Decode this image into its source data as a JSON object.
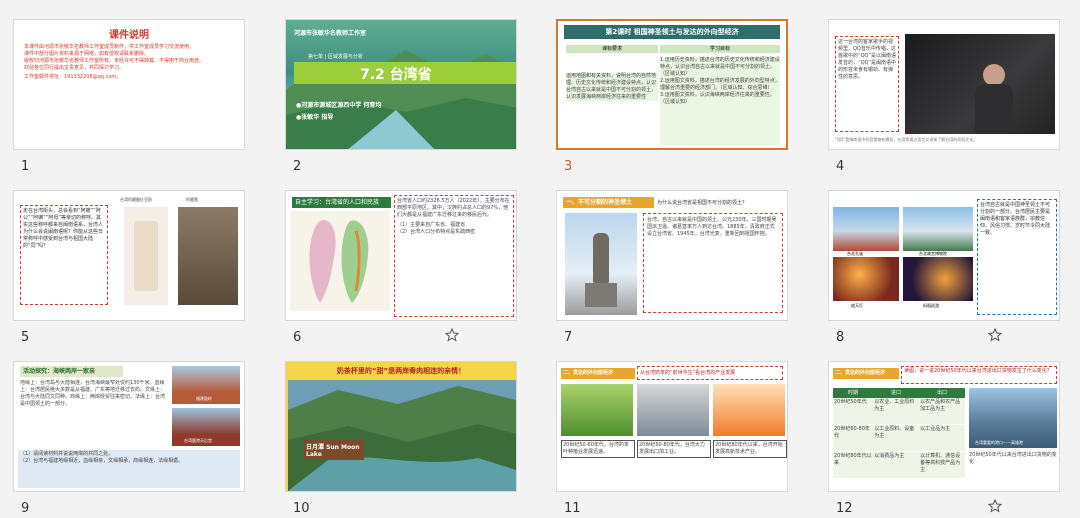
{
  "slides": [
    {
      "num": "1",
      "title": "课件说明",
      "lines": [
        "本课件由河源市张敏华名教师工作室成员制作，供工作室成员学习交流使用。",
        "课件中部分图片资料来源于网络，如有侵权请联系删除。",
        "版权归河源市张敏华名教师工作室所有，未经许可不得转载、不得用于商业用途。",
        "欢迎各位同行提出宝贵意见，共同探讨学习。"
      ],
      "contact": "工作室邮件地址：191332208@qq.com。"
    },
    {
      "num": "2",
      "studio": "河源市张敏华名教师工作室",
      "grade": "第七单 | 区域发展与分析",
      "title": "7.2 台湾省",
      "school": "●河源市源城区源西中学  何育均",
      "teacher": "●张敏华  指导"
    },
    {
      "num": "3",
      "title": "第2课时  祖国神圣领土与发达的外向型经济",
      "col1": "课标要求",
      "col2": "学习目标",
      "req": "运用地图和有关资料，说明台湾的自然地理、历史文化传统和经济建设特点，认识台湾自古以来就是中国不可分割的领土，认识发展海峡两岸经济往来的重要性",
      "goals": [
        "1.运用历史资料，描述台湾的历史文化传统和经济建设特点，认识台湾自古以来就是中国不可分割的领土。（区域认知）",
        "2.运用图文资料，描述台湾的经济发展的外向型特点，理解台湾重要的经济部门。（区域认知、综合思维）",
        "3.运用图文资料，认识海峡两岸经济往来的重要性。（区域认知）"
      ]
    },
    {
      "num": "4",
      "text": "这一台湾的客家歌手的视频里，QQ音乐中传唱，这首歌中的“QQ”是以闽南语发音的，“QQ”是闽南语中的形容米食有嚼劲、有弹性的意思。",
      "footnote": "“QQ”是闽南语中形容食物有嚼劲，台湾常通过语言交流来了解台湾的风俗文化。"
    },
    {
      "num": "5",
      "text": "走在台湾街头，总会看到“阿嬷”“阿公”“阿嫲”“阿母”等亲切的称呼。其实这些称呼都来自闽南语系，台湾人为什么会说闽南语呢？你能从这些日常称呼中感受到台湾与祖国大陆的“同”吗？",
      "tag1": "台湾阿嬷酿红豆奶",
      "tag2": "阿嬷厝"
    },
    {
      "num": "6",
      "header": "自主学习：台湾省的人口和民族",
      "text": "台湾省人口约2326.5万人（2022年），主要分布在西部平原地区。其中，汉族约占总人口的97%，他们大都是从福建广东迁移过来的移民后代。",
      "q1": "（1）主要来自广东省、福建省",
      "q2": "（2）台湾人口分布特点是东疏西密"
    },
    {
      "num": "7",
      "section": "一、不可分割的神圣领土",
      "question": "为什么说台湾省是祖国不可分割的领土？",
      "text": "台湾，自古以来就是中国的领土。公元230年，三国时期吴国派卫温、诸葛直率万人到达台湾。1885年，清政府正式设立台湾省。1945年，台湾光复，重新回到祖国怀抱。"
    },
    {
      "num": "8",
      "text": "台湾自古就是中国神圣领土不可分割的一部分。台湾居民主要是闽南语和客家语族群，宗教信仰、风俗习惯、岁时节令同大陆一致。",
      "captions": [
        "台北孔庙",
        "台北故宫博物院",
        "放天灯",
        "妈祖巡游"
      ]
    },
    {
      "num": "9",
      "header": "活动探究：海峡两岸一家亲",
      "text": "地缘上：台湾岛与大陆相连，台湾海峡最窄处仅约130千米。血缘上：台湾居民绝大多数是从福建、广东等地迁移过去的。文缘上：台湾与大陆同文同种。商缘上：两岸经贸往来密切。法缘上：台湾是中国领土的一部分。",
      "tags": [
        "福建鼓岭",
        "台湾鹿港天后宫"
      ],
      "answers": [
        "（1）请阅读材料并说说两岸的共同之处。",
        "（2）台湾与福建地缘相近，血缘相亲，文缘相承，商缘相连，法缘相循。"
      ]
    },
    {
      "num": "10",
      "title": "奶茶杯里的“甜”是两岸骨肉相连的亲情！",
      "sign": "日月潭 Sun Moon Lake"
    },
    {
      "num": "11",
      "section": "二、发达的外向型经济",
      "question": "从台湾奶茶的“前世今生”看台湾的产业发展",
      "texts": [
        "20世纪50-60年代，台湾的茶叶种植业发展迅速。",
        "20世纪60-80年代，台湾大力发展出口加工业。",
        "20世纪80年代以来，台湾开始发展高新技术产业。"
      ]
    },
    {
      "num": "12",
      "section": "二、发达的外向型经济",
      "question": "读图，说一说20世纪50年代以来台湾进出口货物发生了什么变化？",
      "head": [
        "时期",
        "进口",
        "出口"
      ],
      "rows": [
        [
          "20世纪50年代",
          "以农业、工业原料为主",
          "以农产品和农产品加工品为主"
        ],
        [
          "20世纪60-80年代",
          "以工业原料、设备为主",
          "以工业品为主"
        ],
        [
          "20世纪80年代以来",
          "以消费品为主",
          "以计算机、通信设备等高科技产品为主"
        ]
      ],
      "caption": "台湾重要的港口——高雄港",
      "note": "20世纪50年代以来台湾进出口货物的变化"
    }
  ],
  "colors": {
    "accent": "#d6782e",
    "red": "#d43a2f",
    "green": "#3d9a44",
    "blue": "#2e6fa8"
  }
}
